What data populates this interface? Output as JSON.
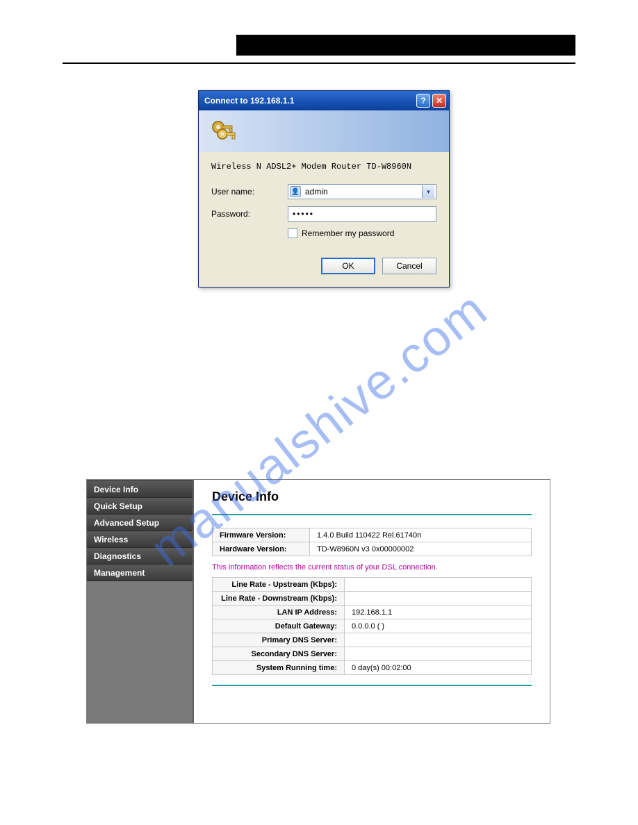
{
  "watermark": "manualshive.com",
  "dialog": {
    "title": "Connect to 192.168.1.1",
    "prompt": "Wireless N ADSL2+ Modem Router TD-W8960N",
    "username_label": "User name:",
    "username_value": "admin",
    "password_label": "Password:",
    "password_value": "•••••",
    "remember_label": "Remember my password",
    "ok_label": "OK",
    "cancel_label": "Cancel"
  },
  "admin": {
    "nav": [
      "Device Info",
      "Quick Setup",
      "Advanced Setup",
      "Wireless",
      "Diagnostics",
      "Management"
    ],
    "heading": "Device Info",
    "version_rows": [
      {
        "k": "Firmware Version:",
        "v": "1.4.0 Build 110422 Rel.61740n"
      },
      {
        "k": "Hardware Version:",
        "v": "TD-W8960N v3 0x00000002"
      }
    ],
    "status_note": "This information reflects the current status of your DSL connection.",
    "status_rows": [
      {
        "k": "Line Rate - Upstream (Kbps):",
        "v": ""
      },
      {
        "k": "Line Rate - Downstream (Kbps):",
        "v": ""
      },
      {
        "k": "LAN IP Address:",
        "v": "192.168.1.1"
      },
      {
        "k": "Default Gateway:",
        "v": "0.0.0.0 ( )"
      },
      {
        "k": "Primary DNS Server:",
        "v": ""
      },
      {
        "k": "Secondary DNS Server:",
        "v": ""
      },
      {
        "k": "System Running time:",
        "v": "0 day(s) 00:02:00"
      }
    ]
  }
}
